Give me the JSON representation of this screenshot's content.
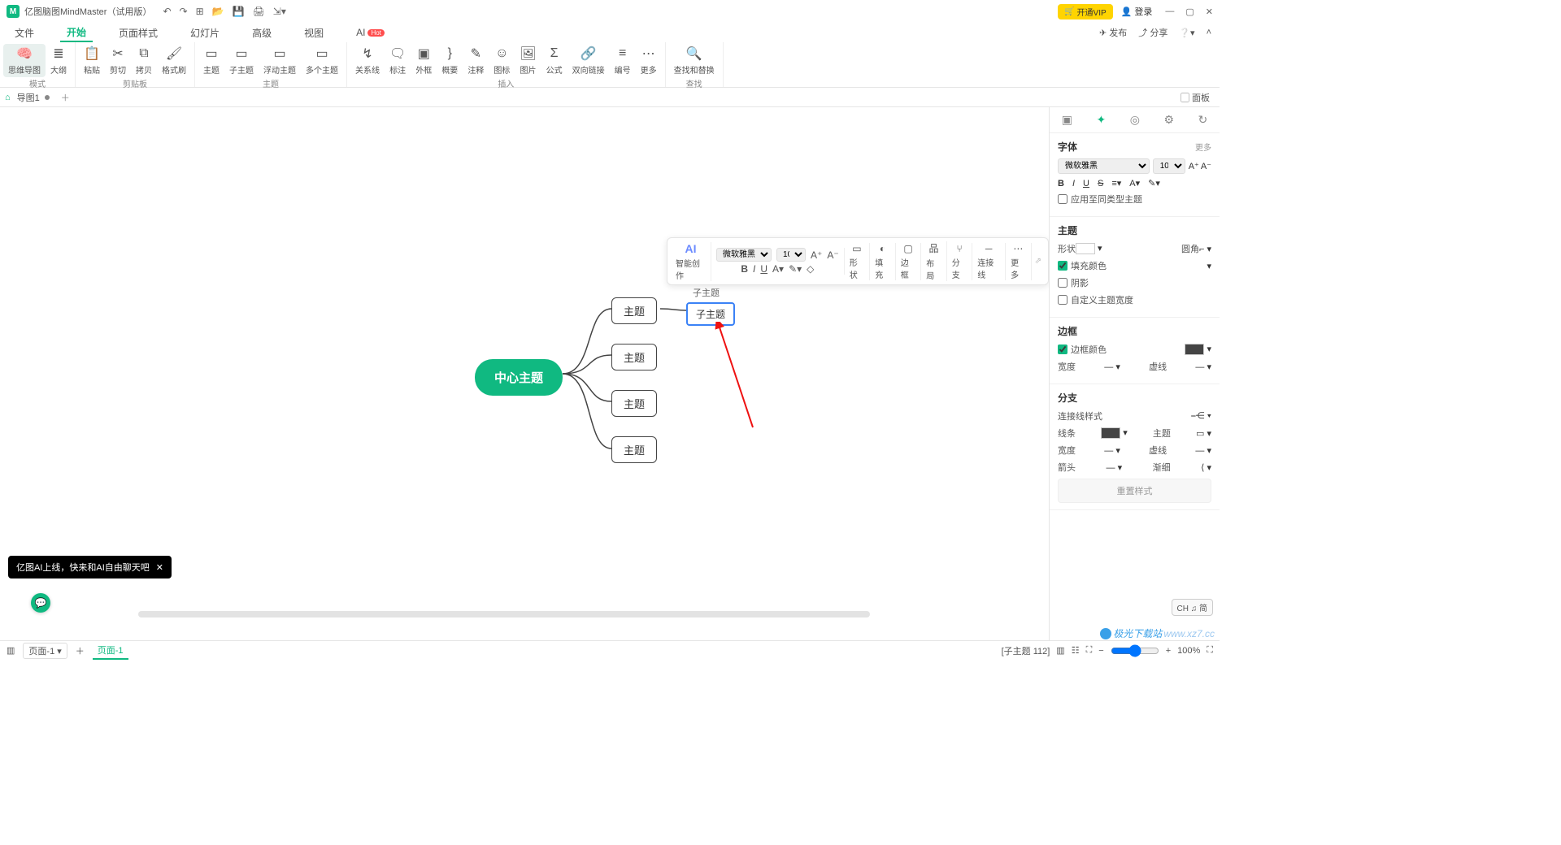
{
  "titlebar": {
    "logo": "M",
    "title": "亿图脑图MindMaster（试用版）",
    "vip": "开通VIP",
    "login": "登录"
  },
  "menu": {
    "tabs": [
      "文件",
      "开始",
      "页面样式",
      "幻灯片",
      "高级",
      "视图"
    ],
    "ai": "AI",
    "hot": "Hot",
    "publish": "发布",
    "share": "分享"
  },
  "ribbon": {
    "mode": {
      "mindmap": "思维导图",
      "outline": "大纲",
      "group": "模式"
    },
    "clipboard": {
      "paste": "粘贴",
      "cut": "剪切",
      "copy": "拷贝",
      "format": "格式刷",
      "group": "剪贴板"
    },
    "topics": {
      "topic": "主题",
      "subtopic": "子主题",
      "float": "浮动主题",
      "multi": "多个主题",
      "group": "主题"
    },
    "insert": {
      "relation": "关系线",
      "callout": "标注",
      "boundary": "外框",
      "summary": "概要",
      "note": "注释",
      "icon": "图标",
      "image": "图片",
      "formula": "公式",
      "hyperlink": "双向链接",
      "number": "编号",
      "more": "更多",
      "group": "插入"
    },
    "find": {
      "find": "查找和替换",
      "group": "查找"
    }
  },
  "tabstrip": {
    "doc": "导图1",
    "panel": "面板"
  },
  "mindmap": {
    "central": "中心主题",
    "topics": [
      "主题",
      "主题",
      "主题",
      "主题"
    ],
    "subtopic": "子主题",
    "sublabel": "子主题"
  },
  "floattb": {
    "ai": "AI",
    "ai_label": "智能创作",
    "font": "微软雅黑",
    "size": "10",
    "shape": "形状",
    "fill": "填充",
    "border": "边框",
    "layout": "布局",
    "branch": "分支",
    "connector": "连接线",
    "more": "更多"
  },
  "panel": {
    "font": {
      "title": "字体",
      "more": "更多",
      "family": "微软雅黑",
      "size": "10",
      "apply": "应用至同类型主题"
    },
    "theme": {
      "title": "主题",
      "shape": "形状",
      "corner": "圆角",
      "fill": "填充颜色",
      "shadow": "阴影",
      "custom": "自定义主题宽度"
    },
    "border": {
      "title": "边框",
      "color": "边框颜色",
      "width": "宽度",
      "dash": "虚线"
    },
    "branch": {
      "title": "分支",
      "style": "连接线样式",
      "line": "线条",
      "theme": "主题",
      "width": "宽度",
      "dash": "虚线",
      "arrow": "箭头",
      "taper": "渐细"
    },
    "reset": "重置样式"
  },
  "ai_toast": "亿图AI上线，快来和AI自由聊天吧",
  "ime": "CH ♫ 简",
  "status": {
    "page": "页面-1",
    "pagetab": "页面-1",
    "selection": "[子主题 112]",
    "zoom": "100%"
  },
  "watermark": "极光下载站"
}
